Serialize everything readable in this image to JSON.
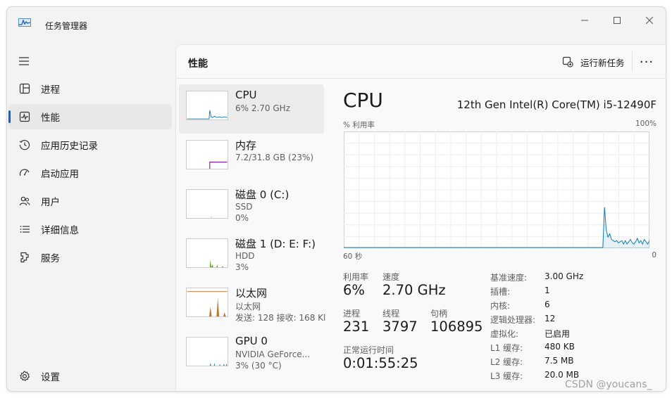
{
  "window": {
    "title": "任务管理器"
  },
  "nav": {
    "items": [
      {
        "label": "进程",
        "icon": "processes-icon"
      },
      {
        "label": "性能",
        "icon": "performance-icon",
        "active": true
      },
      {
        "label": "应用历史记录",
        "icon": "app-history-icon"
      },
      {
        "label": "启动应用",
        "icon": "startup-apps-icon"
      },
      {
        "label": "用户",
        "icon": "users-icon"
      },
      {
        "label": "详细信息",
        "icon": "details-icon"
      },
      {
        "label": "服务",
        "icon": "services-icon"
      }
    ],
    "settings": "设置"
  },
  "header": {
    "title": "性能",
    "run_task": "运行新任务",
    "more": "···"
  },
  "devices": [
    {
      "name": "CPU",
      "sub1": "6% 2.70 GHz",
      "sub2": ""
    },
    {
      "name": "内存",
      "sub1": "7.2/31.8 GB (23%)",
      "sub2": ""
    },
    {
      "name": "磁盘 0 (C:)",
      "sub1": "SSD",
      "sub2": "0%"
    },
    {
      "name": "磁盘 1 (D: E: F:)",
      "sub1": "HDD",
      "sub2": "3%"
    },
    {
      "name": "以太网",
      "sub1": "以太网",
      "sub2": "发送: 128 接收: 168 Kl"
    },
    {
      "name": "GPU 0",
      "sub1": "NVIDIA GeForce...",
      "sub2": "3% (30 °C)"
    }
  ],
  "detail": {
    "title": "CPU",
    "model": "12th Gen Intel(R) Core(TM) i5-12490F",
    "util_label": "% 利用率",
    "util_max": "100%",
    "time_left": "60 秒",
    "time_right": "0",
    "stats": {
      "utilization_label": "利用率",
      "utilization": "6%",
      "speed_label": "速度",
      "speed": "2.70 GHz",
      "processes_label": "进程",
      "processes": "231",
      "threads_label": "线程",
      "threads": "3797",
      "handles_label": "句柄",
      "handles": "106895",
      "uptime_label": "正常运行时间",
      "uptime": "0:01:55:25"
    },
    "specs": [
      {
        "k": "基准速度:",
        "v": "3.00 GHz"
      },
      {
        "k": "插槽:",
        "v": "1"
      },
      {
        "k": "内核:",
        "v": "6"
      },
      {
        "k": "逻辑处理器:",
        "v": "12"
      },
      {
        "k": "虚拟化:",
        "v": "已启用"
      },
      {
        "k": "L1 缓存:",
        "v": "480 KB"
      },
      {
        "k": "L2 缓存:",
        "v": "7.5 MB"
      },
      {
        "k": "L3 缓存:",
        "v": "20.0 MB"
      }
    ],
    "cpu_history_percent": [
      0,
      0,
      0,
      0,
      0,
      0,
      0,
      0,
      0,
      0,
      0,
      0,
      0,
      0,
      0,
      0,
      0,
      0,
      0,
      0,
      0,
      0,
      0,
      0,
      0,
      0,
      0,
      0,
      0,
      0,
      0,
      0,
      0,
      0,
      0,
      0,
      0,
      0,
      0,
      0,
      0,
      0,
      0,
      0,
      0,
      0,
      0,
      0,
      0,
      0,
      0,
      0,
      0,
      0,
      0,
      0,
      0,
      0,
      0,
      0,
      0,
      0,
      0,
      0,
      0,
      0,
      0,
      0,
      0,
      0,
      0,
      0,
      0,
      0,
      0,
      0,
      0,
      0,
      0,
      0,
      0,
      0,
      0,
      0,
      0,
      0,
      0,
      0,
      0,
      0,
      0,
      0,
      0,
      0,
      0,
      0,
      0,
      0,
      0,
      0,
      0,
      0,
      0,
      0,
      0,
      0,
      0,
      0,
      0,
      0,
      0,
      0,
      0,
      0,
      0,
      0,
      0,
      0,
      0,
      0,
      0,
      0,
      0,
      0,
      0,
      0,
      0,
      0,
      0,
      0,
      0,
      0,
      0,
      0,
      0,
      0,
      0,
      0,
      0,
      0,
      0,
      0,
      0,
      0,
      0,
      0,
      0,
      0,
      0,
      0,
      0,
      35,
      15,
      9,
      12,
      7,
      6,
      5,
      6,
      4,
      5,
      6,
      3,
      6,
      3,
      5,
      7,
      4,
      3,
      5,
      8,
      4,
      6,
      3,
      7,
      5,
      3,
      6
    ]
  },
  "colors": {
    "cpu": "#117dbb",
    "memory": "#8b12ae",
    "disk": "#4da60c",
    "ethernet": "#a74f01",
    "gpu": "#0b8ad8",
    "accent": "#2b5ba7"
  },
  "watermark": "CSDN @youcans_"
}
